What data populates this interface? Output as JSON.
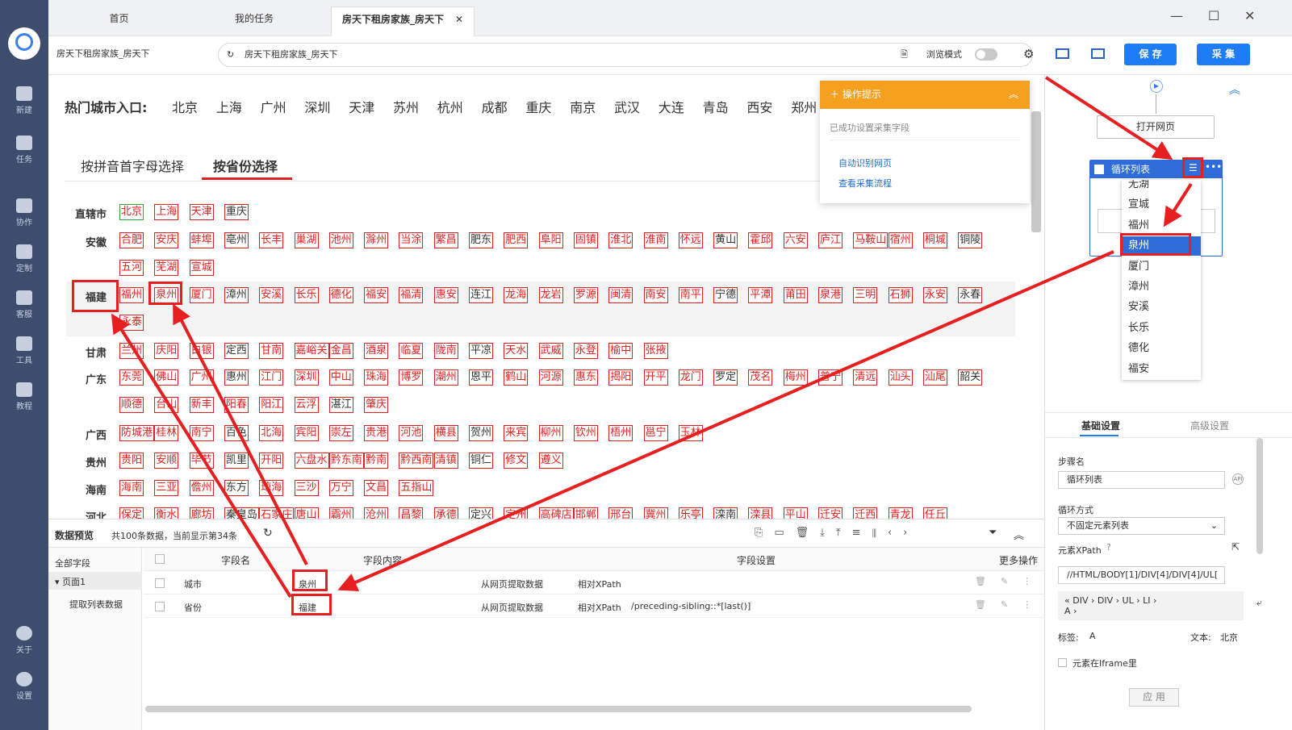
{
  "nav": [
    {
      "label": "新建",
      "icon": "plus-square-icon"
    },
    {
      "label": "任务",
      "icon": "task-icon"
    },
    {
      "label": "协作",
      "icon": "users-icon"
    },
    {
      "label": "定制",
      "icon": "heart-icon"
    },
    {
      "label": "客服",
      "icon": "headset-icon"
    },
    {
      "label": "工具",
      "icon": "toolbox-icon"
    },
    {
      "label": "教程",
      "icon": "graduation-icon"
    },
    {
      "label": "关于",
      "icon": "info-icon"
    },
    {
      "label": "设置",
      "icon": "gear-icon"
    }
  ],
  "tabs": [
    {
      "label": "首页"
    },
    {
      "label": "我的任务"
    },
    {
      "label": "房天下租房家族_房天下"
    }
  ],
  "address": {
    "task_name": "房天下租房家族_房天下",
    "url": "房天下租房家族_房天下",
    "browse_mode": "浏览模式",
    "save": "保 存",
    "collect": "采 集"
  },
  "page": {
    "hot_label": "热门城市入口:",
    "hot_cities": [
      "北京",
      "上海",
      "广州",
      "深圳",
      "天津",
      "苏州",
      "杭州",
      "成都",
      "重庆",
      "南京",
      "武汉",
      "大连",
      "青岛",
      "西安",
      "郑州"
    ],
    "mode_tabs": [
      "按拼音首字母选择",
      "按省份选择"
    ],
    "provinces": [
      {
        "name": "直辖市",
        "cities": [
          "北京",
          "上海",
          "天津",
          "重庆"
        ]
      },
      {
        "name": "安徽",
        "cities": [
          "合肥",
          "安庆",
          "蚌埠",
          "亳州",
          "长丰",
          "巢湖",
          "池州",
          "滁州",
          "当涂",
          "繁昌",
          "肥东",
          "肥西",
          "阜阳",
          "固镇",
          "淮北",
          "淮南",
          "怀远",
          "黄山",
          "霍邱",
          "六安",
          "庐江",
          "马鞍山",
          "宿州",
          "桐城",
          "铜陵",
          "五河",
          "芜湖",
          "宣城"
        ]
      },
      {
        "name": "福建",
        "cities": [
          "福州",
          "泉州",
          "厦门",
          "漳州",
          "安溪",
          "长乐",
          "德化",
          "福安",
          "福清",
          "惠安",
          "连江",
          "龙海",
          "龙岩",
          "罗源",
          "闽清",
          "南安",
          "南平",
          "宁德",
          "平潭",
          "莆田",
          "泉港",
          "三明",
          "石狮",
          "永安",
          "永春",
          "永泰"
        ]
      },
      {
        "name": "甘肃",
        "cities": [
          "兰州",
          "庆阳",
          "白银",
          "定西",
          "甘南",
          "嘉峪关",
          "金昌",
          "酒泉",
          "临夏",
          "陇南",
          "平凉",
          "天水",
          "武威",
          "永登",
          "榆中",
          "张掖"
        ]
      },
      {
        "name": "广东",
        "cities": [
          "东莞",
          "佛山",
          "广州",
          "惠州",
          "江门",
          "深圳",
          "中山",
          "珠海",
          "博罗",
          "潮州",
          "恩平",
          "鹤山",
          "河源",
          "惠东",
          "揭阳",
          "开平",
          "龙门",
          "罗定",
          "茂名",
          "梅州",
          "普宁",
          "清远",
          "汕头",
          "汕尾",
          "韶关",
          "顺德",
          "台山",
          "新丰",
          "阳春",
          "阳江",
          "云浮",
          "湛江",
          "肇庆"
        ]
      },
      {
        "name": "广西",
        "cities": [
          "防城港",
          "桂林",
          "南宁",
          "百色",
          "北海",
          "宾阳",
          "崇左",
          "贵港",
          "河池",
          "横县",
          "贺州",
          "来宾",
          "柳州",
          "钦州",
          "梧州",
          "邕宁",
          "玉林"
        ]
      },
      {
        "name": "贵州",
        "cities": [
          "贵阳",
          "安顺",
          "毕节",
          "凯里",
          "开阳",
          "六盘水",
          "黔东南",
          "黔南",
          "黔西南",
          "清镇",
          "铜仁",
          "修文",
          "遵义"
        ]
      },
      {
        "name": "海南",
        "cities": [
          "海南",
          "三亚",
          "儋州",
          "东方",
          "琼海",
          "三沙",
          "万宁",
          "文昌",
          "五指山"
        ]
      },
      {
        "name": "河北",
        "cities": [
          "保定",
          "衡水",
          "廊坊",
          "秦皇岛",
          "石家庄",
          "唐山",
          "霸州",
          "沧州",
          "昌黎",
          "承德",
          "定兴",
          "定州",
          "高碑店",
          "邯郸",
          "邢台",
          "冀州",
          "乐亭",
          "滦南",
          "滦县",
          "平山",
          "迁安",
          "迁西",
          "青龙",
          "任丘"
        ]
      }
    ]
  },
  "tip": {
    "title": "操作提示",
    "msg": "已成功设置采集字段",
    "links": [
      "自动识别网页",
      "查看采集流程"
    ]
  },
  "preview": {
    "title": "数据预览",
    "count": "共100条数据，当前显示第34条",
    "tree": [
      "全部字段",
      "页面1",
      "提取列表数据"
    ],
    "headers": [
      "字段名",
      "字段内容",
      "字段设置",
      "更多操作"
    ],
    "rows": [
      {
        "name": "城市",
        "value": "泉州",
        "source": "从网页提取数据",
        "xp": "相对XPath",
        "xpath": ""
      },
      {
        "name": "省份",
        "value": "福建",
        "source": "从网页提取数据",
        "xp": "相对XPath",
        "xpath": "/preceding-sibling::*[last()]"
      }
    ]
  },
  "flow": {
    "open": "打开网页",
    "loop": "循环列表",
    "dropdown": [
      "无湖",
      "宣城",
      "福州",
      "泉州",
      "厦门",
      "漳州",
      "安溪",
      "长乐",
      "德化",
      "福安"
    ]
  },
  "settings": {
    "tabs": [
      "基础设置",
      "高级设置"
    ],
    "step_label": "步骤名",
    "step_value": "循环列表",
    "loop_label": "循环方式",
    "loop_value": "不固定元素列表",
    "xpath_label": "元素XPath",
    "xpath_value": "//HTML/BODY[1]/DIV[4]/DIV[4]/UL[",
    "crumb": [
      "DIV",
      "DIV",
      "UL",
      "LI",
      "A"
    ],
    "tag_label": "标签:",
    "tag_value": "A",
    "text_label": "文本:",
    "text_value": "北京",
    "iframe_label": "元素在Iframe里",
    "apply": "应 用"
  },
  "colors": {
    "nav": "#3e4c6e",
    "accent": "#1e7cf5",
    "warn": "#f6a020",
    "red": "#e62020"
  }
}
